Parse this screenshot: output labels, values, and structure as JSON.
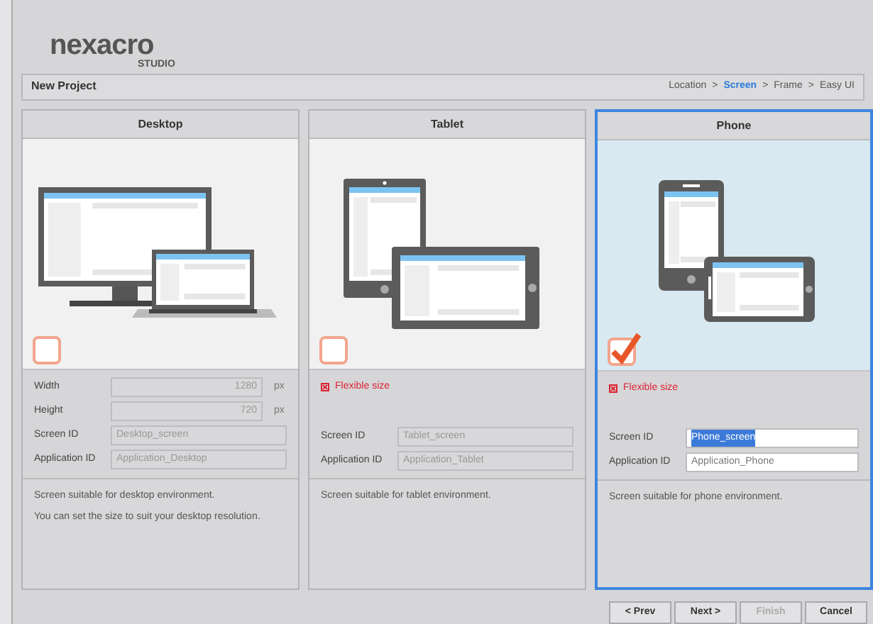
{
  "logo": {
    "brand": "nexacro",
    "sub": "STUDIO"
  },
  "header": {
    "title": "New Project",
    "breadcrumb": [
      {
        "kind": "step",
        "label": "Location",
        "selected": false
      },
      {
        "kind": "sep",
        "label": ">"
      },
      {
        "kind": "step",
        "label": "Screen",
        "selected": true
      },
      {
        "kind": "sep",
        "label": ">"
      },
      {
        "kind": "step",
        "label": "Frame",
        "selected": false
      },
      {
        "kind": "sep",
        "label": ">"
      },
      {
        "kind": "step",
        "label": "Easy UI",
        "selected": false
      }
    ]
  },
  "cards": [
    {
      "title": "Desktop",
      "kind": "desktop",
      "selected": false,
      "checked": false,
      "fields": [
        {
          "kind": "size",
          "label": "Width",
          "value": "1280",
          "unit": "px",
          "disabled": true,
          "highlighted": false
        },
        {
          "kind": "size",
          "label": "Height",
          "value": "720",
          "unit": "px",
          "disabled": true,
          "highlighted": false
        },
        {
          "kind": "text",
          "label": "Screen ID",
          "value": "Desktop_screen",
          "disabled": true,
          "highlighted": false
        },
        {
          "kind": "text",
          "label": "Application ID",
          "value": "Application_Desktop",
          "disabled": true,
          "highlighted": false
        }
      ],
      "description": [
        "Screen suitable for desktop environment.",
        "You can set the size to suit your desktop resolution."
      ]
    },
    {
      "title": "Tablet",
      "kind": "tablet",
      "selected": false,
      "checked": false,
      "flexible_note": "Flexible size",
      "fields": [
        {
          "kind": "text",
          "label": "Screen ID",
          "value": "Tablet_screen",
          "disabled": true,
          "highlighted": false
        },
        {
          "kind": "text",
          "label": "Application ID",
          "value": "Application_Tablet",
          "disabled": true,
          "highlighted": false
        }
      ],
      "description": [
        "Screen suitable for tablet environment."
      ]
    },
    {
      "title": "Phone",
      "kind": "phone",
      "selected": true,
      "checked": true,
      "flexible_note": "Flexible size",
      "fields": [
        {
          "kind": "text",
          "label": "Screen ID",
          "value": "Phone_screen",
          "disabled": false,
          "highlighted": true
        },
        {
          "kind": "text",
          "label": "Application ID",
          "value": "Application_Phone",
          "disabled": false,
          "highlighted": false
        }
      ],
      "description": [
        "Screen suitable for phone environment."
      ]
    }
  ],
  "buttons": [
    {
      "label": "< Prev",
      "disabled": false
    },
    {
      "label": "Next >",
      "disabled": false
    },
    {
      "label": "Finish",
      "disabled": true
    },
    {
      "label": "Cancel",
      "disabled": false
    }
  ]
}
